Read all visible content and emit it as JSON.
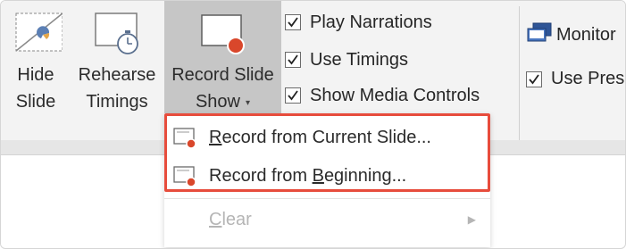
{
  "ribbon": {
    "hide_slide": {
      "line1": "Hide",
      "line2": "Slide",
      "icon": "hide-slide-icon"
    },
    "rehearse_timings": {
      "line1": "Rehearse",
      "line2": "Timings",
      "icon": "stopwatch-slide-icon"
    },
    "record_slide_show": {
      "line1": "Record Slide",
      "line2": "Show",
      "caret": "▾",
      "icon": "record-slide-icon"
    },
    "checkboxes": [
      {
        "label": "Play Narrations",
        "checked": true
      },
      {
        "label": "Use Timings",
        "checked": true
      },
      {
        "label": "Show Media Controls",
        "checked": true
      }
    ],
    "monitor": {
      "label": "Monitor",
      "icon": "monitor-icon"
    },
    "use_presenter": {
      "label": "Use Pres",
      "checked": true
    }
  },
  "record_menu": {
    "items": [
      {
        "pre": "",
        "accel": "R",
        "post": "ecord from Current Slide...",
        "enabled": true
      },
      {
        "pre": "Record from ",
        "accel": "B",
        "post": "eginning...",
        "enabled": true
      },
      {
        "pre": "",
        "accel": "C",
        "post": "lear",
        "enabled": false,
        "has_submenu": true,
        "submenu_arrow": "▶"
      }
    ]
  },
  "colors": {
    "highlight_border": "#e74c3c",
    "record_dot": "#d9472b",
    "ribbon_bg": "#f3f3f3",
    "selected_button_bg": "#c6c6c6"
  }
}
